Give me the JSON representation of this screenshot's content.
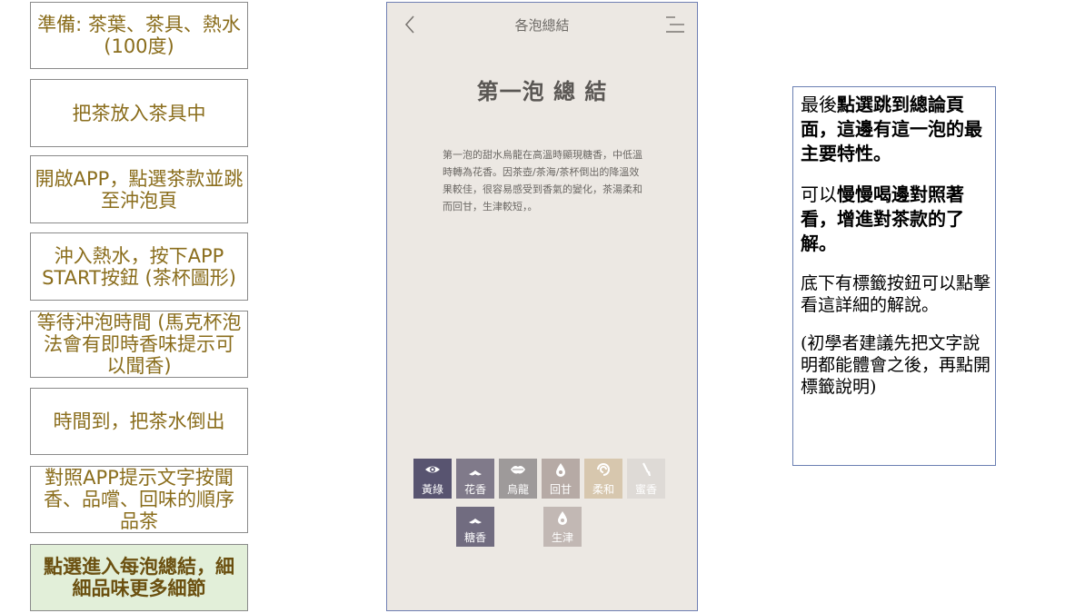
{
  "steps": [
    {
      "text": "準備: 茶葉、茶具、熱水 (100度)"
    },
    {
      "text": "把茶放入茶具中"
    },
    {
      "text": "開啟APP，點選茶款並跳至沖泡頁"
    },
    {
      "text": "沖入熱水，按下APP START按鈕 (茶杯圖形)"
    },
    {
      "text": "等待沖泡時間 (馬克杯泡法會有即時香味提示可以聞香)"
    },
    {
      "text": "時間到，把茶水倒出"
    },
    {
      "text": "對照APP提示文字按聞香、品嚐、回味的順序品茶"
    },
    {
      "text": "點選進入每泡總結，細細品味更多細節"
    }
  ],
  "phone": {
    "title": "各泡總結",
    "heading": "第一泡 總 結",
    "summary": "第一泡的甜水烏龍在高溫時顯現糖香，中低溫時轉為花香。因茶壺/茶海/茶杯倒出的降溫效果較佳，很容易感受到香氣的變化，茶湯柔和而回甘，生津較短，。",
    "tags": [
      {
        "label": "黃綠",
        "icon": "eye-icon",
        "color": "#585470"
      },
      {
        "label": "花香",
        "icon": "nose-icon",
        "color": "#807a8a"
      },
      {
        "label": "烏龍",
        "icon": "lips-icon",
        "color": "#9e9a9a"
      },
      {
        "label": "回甘",
        "icon": "drop-icon",
        "color": "#b6aaa5"
      },
      {
        "label": "柔和",
        "icon": "swirl-icon",
        "color": "#d7c7ae"
      },
      {
        "label": "蜜香",
        "icon": "brush-icon",
        "color": "#dedad6"
      },
      {
        "label": "糖香",
        "icon": "nose-icon",
        "color": "#716c80"
      },
      {
        "label": "生津",
        "icon": "drop-icon",
        "color": "#c2b8b4"
      }
    ]
  },
  "notes": {
    "p1_a": "最後",
    "p1_b": "點選跳到總論頁面，這邊有這一泡的最主要特性。",
    "p2_a": "可以",
    "p2_b": "慢慢喝邊對照著看，增進對茶款的了解。",
    "p3": "底下有標籤按鈕可以點擊看這詳細的解說。",
    "p4": "(初學者建議先把文字說明都能體會之後，再點開標籤說明)"
  }
}
